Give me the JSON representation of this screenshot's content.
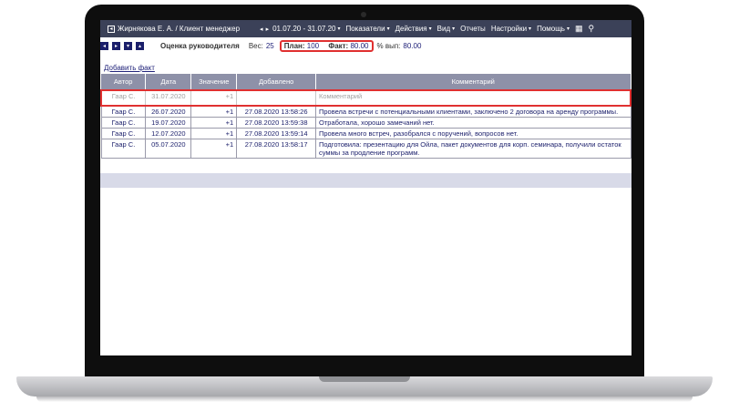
{
  "topbar": {
    "title": "Жирнякова Е. А. / Клиент менеджер",
    "period": "01.07.20 - 31.07.20",
    "menus": [
      "Показатели",
      "Действия",
      "Вид",
      "Отчеты",
      "Настройки",
      "Помощь"
    ]
  },
  "controls": {
    "indicator": "Оценка руководителя",
    "weight_label": "Вес:",
    "weight_value": "25",
    "plan_label": "План:",
    "plan_value": "100",
    "fact_label": "Факт:",
    "fact_value": "80.00",
    "completion_label": "% вып:",
    "completion_value": "80.00"
  },
  "add_fact_link": "Добавить факт",
  "table": {
    "headers": [
      "Автор",
      "Дата",
      "Значение",
      "Добавлено",
      "Комментарий"
    ],
    "draft": {
      "author": "Гаар С.",
      "date": "31.07.2020",
      "value": "+1",
      "added": "",
      "comment": "Комментарий"
    },
    "rows": [
      {
        "author": "Гаар С.",
        "date": "26.07.2020",
        "value": "+1",
        "added": "27.08.2020 13:58:26",
        "comment": "Провела встречи с потенциальными клиентами, заключено 2 договора на аренду программы."
      },
      {
        "author": "Гаар С.",
        "date": "19.07.2020",
        "value": "+1",
        "added": "27.08.2020 13:59:38",
        "comment": "Отработала, хорошо замечаний нет."
      },
      {
        "author": "Гаар С.",
        "date": "12.07.2020",
        "value": "+1",
        "added": "27.08.2020 13:59:14",
        "comment": "Провела много встреч, разобрался с поручений, вопросов нет."
      },
      {
        "author": "Гаар С.",
        "date": "05.07.2020",
        "value": "+1",
        "added": "27.08.2020 13:58:17",
        "comment": "Подготовила: презентацию для Ойла, пакет документов для корп. семинара, получили остаток суммы за продление программ."
      }
    ]
  }
}
